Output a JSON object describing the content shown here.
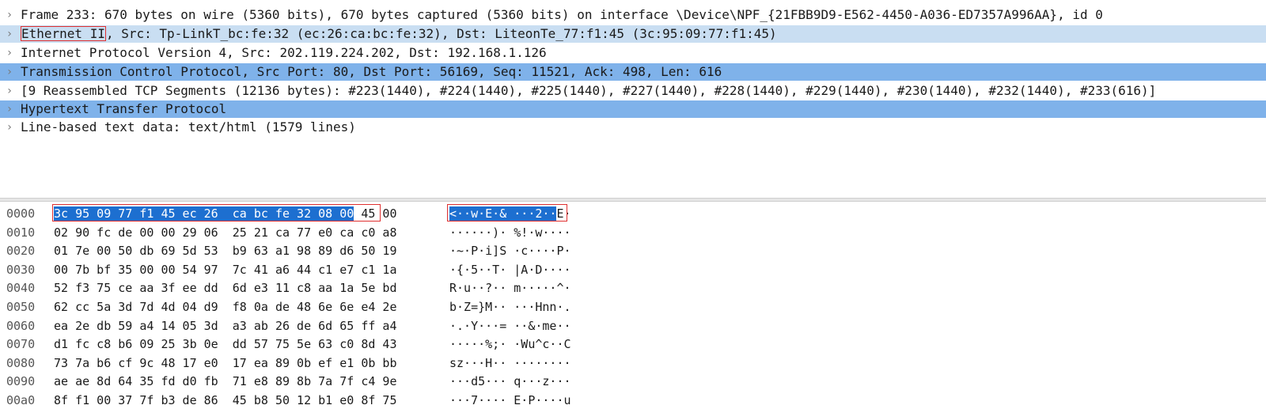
{
  "packet_details": [
    {
      "text": "Frame 233: 670 bytes on wire (5360 bits), 670 bytes captured (5360 bits) on interface \\Device\\NPF_{21FBB9D9-E562-4450-A036-ED7357A996AA}, id 0"
    },
    {
      "head": "Ethernet II",
      "text": ", Src: Tp-LinkT_bc:fe:32 (ec:26:ca:bc:fe:32), Dst: LiteonTe_77:f1:45 (3c:95:09:77:f1:45)"
    },
    {
      "text": "Internet Protocol Version 4, Src: 202.119.224.202, Dst: 192.168.1.126"
    },
    {
      "text": "Transmission Control Protocol, Src Port: 80, Dst Port: 56169, Seq: 11521, Ack: 498, Len: 616"
    },
    {
      "text": "[9 Reassembled TCP Segments (12136 bytes): #223(1440), #224(1440), #225(1440), #227(1440), #228(1440), #229(1440), #230(1440), #232(1440), #233(616)]"
    },
    {
      "text": "Hypertext Transfer Protocol"
    },
    {
      "text": "Line-based text data: text/html (1579 lines)"
    }
  ],
  "expander_glyph": "›",
  "hex_rows": [
    {
      "offset": "0000",
      "sel_bytes": "3c 95 09 77 f1 45 ec 26  ca bc fe 32 08 00",
      "rest_bytes": " 45 00",
      "sel_ascii": "<··w·E·& ···2··",
      "rest_ascii": "E·"
    },
    {
      "offset": "0010",
      "bytes": "02 90 fc de 00 00 29 06  25 21 ca 77 e0 ca c0 a8",
      "ascii": "······)· %!·w····"
    },
    {
      "offset": "0020",
      "bytes": "01 7e 00 50 db 69 5d 53  b9 63 a1 98 89 d6 50 19",
      "ascii": "·~·P·i]S ·c····P·"
    },
    {
      "offset": "0030",
      "bytes": "00 7b bf 35 00 00 54 97  7c 41 a6 44 c1 e7 c1 1a",
      "ascii": "·{·5··T· |A·D····"
    },
    {
      "offset": "0040",
      "bytes": "52 f3 75 ce aa 3f ee dd  6d e3 11 c8 aa 1a 5e bd",
      "ascii": "R·u··?·· m·····^·"
    },
    {
      "offset": "0050",
      "bytes": "62 cc 5a 3d 7d 4d 04 d9  f8 0a de 48 6e 6e e4 2e",
      "ascii": "b·Z=}M·· ···Hnn·."
    },
    {
      "offset": "0060",
      "bytes": "ea 2e db 59 a4 14 05 3d  a3 ab 26 de 6d 65 ff a4",
      "ascii": "·.·Y···= ··&·me··"
    },
    {
      "offset": "0070",
      "bytes": "d1 fc c8 b6 09 25 3b 0e  dd 57 75 5e 63 c0 8d 43",
      "ascii": "·····%;· ·Wu^c··C"
    },
    {
      "offset": "0080",
      "bytes": "73 7a b6 cf 9c 48 17 e0  17 ea 89 0b ef e1 0b bb",
      "ascii": "sz···H·· ········"
    },
    {
      "offset": "0090",
      "bytes": "ae ae 8d 64 35 fd d0 fb  71 e8 89 8b 7a 7f c4 9e",
      "ascii": "···d5··· q···z···"
    },
    {
      "offset": "00a0",
      "bytes": "8f f1 00 37 7f b3 de 86  45 b8 50 12 b1 e0 8f 75",
      "ascii": "···7···· E·P····u"
    }
  ]
}
